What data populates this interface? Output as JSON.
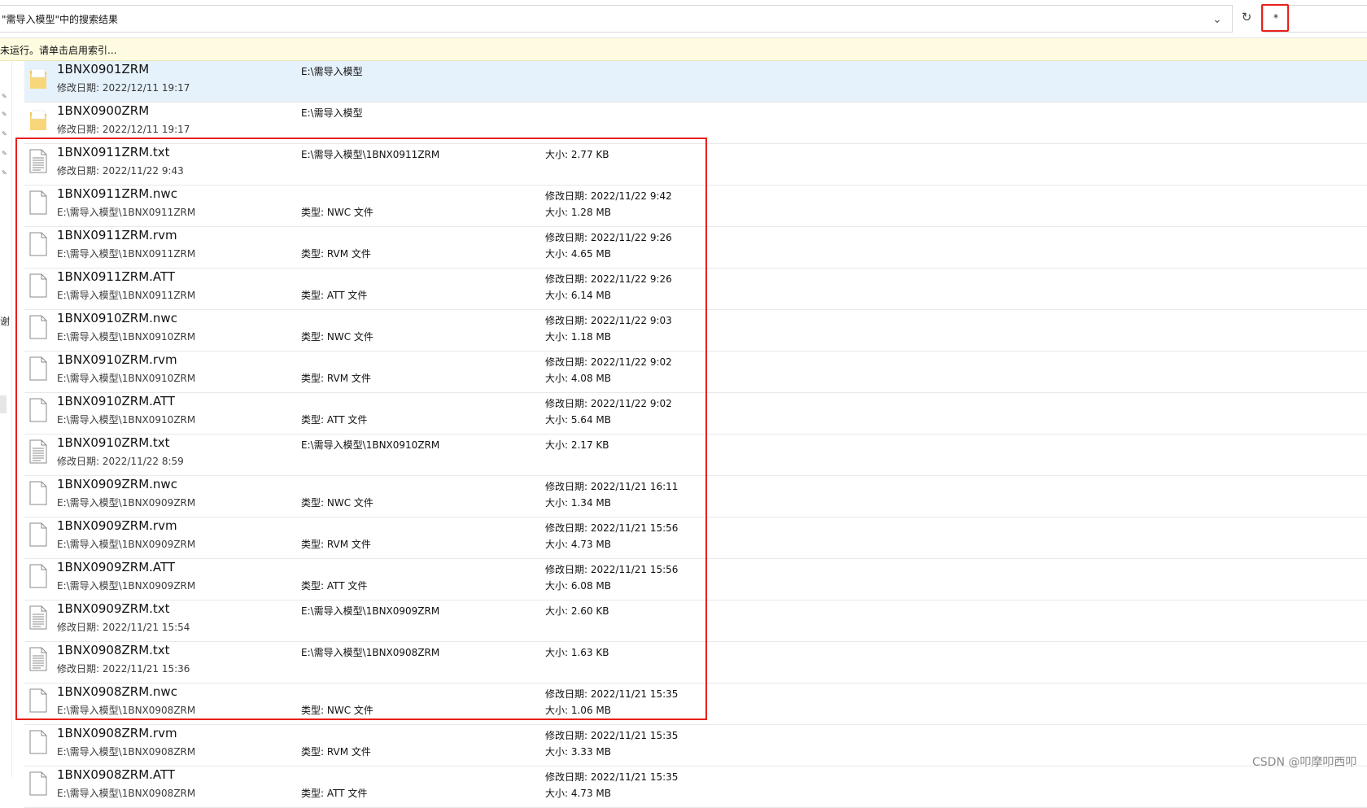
{
  "address_bar": {
    "text": "\"需导入模型\"中的搜索结果",
    "chevron": "⌄",
    "refresh_icon": "↻"
  },
  "search": {
    "value": "*"
  },
  "infobar": {
    "text": "未运行。请单击启用索引..."
  },
  "leftnav": {
    "char": "谢"
  },
  "files": [
    {
      "name": "1BNX0901ZRM",
      "icon": "folder-icon",
      "sub": "修改日期: 2022/12/11 19:17",
      "col2": "E:\\需导入模型",
      "col2_pos": "top",
      "col3a": "",
      "col3b": "",
      "selected": true
    },
    {
      "name": "1BNX0900ZRM",
      "icon": "folder-icon",
      "sub": "修改日期: 2022/12/11 19:17",
      "col2": "E:\\需导入模型",
      "col2_pos": "top",
      "col3a": "",
      "col3b": "",
      "selected": false
    },
    {
      "name": "1BNX0911ZRM.txt",
      "icon": "text-file-icon",
      "sub": "修改日期: 2022/11/22 9:43",
      "col2": "E:\\需导入模型\\1BNX0911ZRM",
      "col2_pos": "top",
      "col3a": "大小: 2.77 KB",
      "col3b": "",
      "selected": false
    },
    {
      "name": "1BNX0911ZRM.nwc",
      "icon": "file-icon",
      "sub": "E:\\需导入模型\\1BNX0911ZRM",
      "col2": "类型: NWC 文件",
      "col2_pos": "low",
      "col3a": "修改日期: 2022/11/22 9:42",
      "col3b": "大小: 1.28 MB",
      "selected": false
    },
    {
      "name": "1BNX0911ZRM.rvm",
      "icon": "file-icon",
      "sub": "E:\\需导入模型\\1BNX0911ZRM",
      "col2": "类型: RVM 文件",
      "col2_pos": "low",
      "col3a": "修改日期: 2022/11/22 9:26",
      "col3b": "大小: 4.65 MB",
      "selected": false
    },
    {
      "name": "1BNX0911ZRM.ATT",
      "icon": "file-icon",
      "sub": "E:\\需导入模型\\1BNX0911ZRM",
      "col2": "类型: ATT 文件",
      "col2_pos": "low",
      "col3a": "修改日期: 2022/11/22 9:26",
      "col3b": "大小: 6.14 MB",
      "selected": false
    },
    {
      "name": "1BNX0910ZRM.nwc",
      "icon": "file-icon",
      "sub": "E:\\需导入模型\\1BNX0910ZRM",
      "col2": "类型: NWC 文件",
      "col2_pos": "low",
      "col3a": "修改日期: 2022/11/22 9:03",
      "col3b": "大小: 1.18 MB",
      "selected": false
    },
    {
      "name": "1BNX0910ZRM.rvm",
      "icon": "file-icon",
      "sub": "E:\\需导入模型\\1BNX0910ZRM",
      "col2": "类型: RVM 文件",
      "col2_pos": "low",
      "col3a": "修改日期: 2022/11/22 9:02",
      "col3b": "大小: 4.08 MB",
      "selected": false
    },
    {
      "name": "1BNX0910ZRM.ATT",
      "icon": "file-icon",
      "sub": "E:\\需导入模型\\1BNX0910ZRM",
      "col2": "类型: ATT 文件",
      "col2_pos": "low",
      "col3a": "修改日期: 2022/11/22 9:02",
      "col3b": "大小: 5.64 MB",
      "selected": false
    },
    {
      "name": "1BNX0910ZRM.txt",
      "icon": "text-file-icon",
      "sub": "修改日期: 2022/11/22 8:59",
      "col2": "E:\\需导入模型\\1BNX0910ZRM",
      "col2_pos": "top",
      "col3a": "大小: 2.17 KB",
      "col3b": "",
      "selected": false
    },
    {
      "name": "1BNX0909ZRM.nwc",
      "icon": "file-icon",
      "sub": "E:\\需导入模型\\1BNX0909ZRM",
      "col2": "类型: NWC 文件",
      "col2_pos": "low",
      "col3a": "修改日期: 2022/11/21 16:11",
      "col3b": "大小: 1.34 MB",
      "selected": false
    },
    {
      "name": "1BNX0909ZRM.rvm",
      "icon": "file-icon",
      "sub": "E:\\需导入模型\\1BNX0909ZRM",
      "col2": "类型: RVM 文件",
      "col2_pos": "low",
      "col3a": "修改日期: 2022/11/21 15:56",
      "col3b": "大小: 4.73 MB",
      "selected": false
    },
    {
      "name": "1BNX0909ZRM.ATT",
      "icon": "file-icon",
      "sub": "E:\\需导入模型\\1BNX0909ZRM",
      "col2": "类型: ATT 文件",
      "col2_pos": "low",
      "col3a": "修改日期: 2022/11/21 15:56",
      "col3b": "大小: 6.08 MB",
      "selected": false
    },
    {
      "name": "1BNX0909ZRM.txt",
      "icon": "text-file-icon",
      "sub": "修改日期: 2022/11/21 15:54",
      "col2": "E:\\需导入模型\\1BNX0909ZRM",
      "col2_pos": "top",
      "col3a": "大小: 2.60 KB",
      "col3b": "",
      "selected": false
    },
    {
      "name": "1BNX0908ZRM.txt",
      "icon": "text-file-icon",
      "sub": "修改日期: 2022/11/21 15:36",
      "col2": "E:\\需导入模型\\1BNX0908ZRM",
      "col2_pos": "top",
      "col3a": "大小: 1.63 KB",
      "col3b": "",
      "selected": false
    },
    {
      "name": "1BNX0908ZRM.nwc",
      "icon": "file-icon",
      "sub": "E:\\需导入模型\\1BNX0908ZRM",
      "col2": "类型: NWC 文件",
      "col2_pos": "low",
      "col3a": "修改日期: 2022/11/21 15:35",
      "col3b": "大小: 1.06 MB",
      "selected": false
    },
    {
      "name": "1BNX0908ZRM.rvm",
      "icon": "file-icon",
      "sub": "E:\\需导入模型\\1BNX0908ZRM",
      "col2": "类型: RVM 文件",
      "col2_pos": "low",
      "col3a": "修改日期: 2022/11/21 15:35",
      "col3b": "大小: 3.33 MB",
      "selected": false
    },
    {
      "name": "1BNX0908ZRM.ATT",
      "icon": "file-icon",
      "sub": "E:\\需导入模型\\1BNX0908ZRM",
      "col2": "类型: ATT 文件",
      "col2_pos": "low",
      "col3a": "修改日期: 2022/11/21 15:35",
      "col3b": "大小: 4.73 MB",
      "selected": false
    }
  ],
  "watermark": "CSDN @叩摩叩西叩",
  "colors": {
    "highlight": "#e8201a",
    "selected_row": "#e5f1fb",
    "infobar": "#fffbe0",
    "folder": "#f5cf6b"
  }
}
